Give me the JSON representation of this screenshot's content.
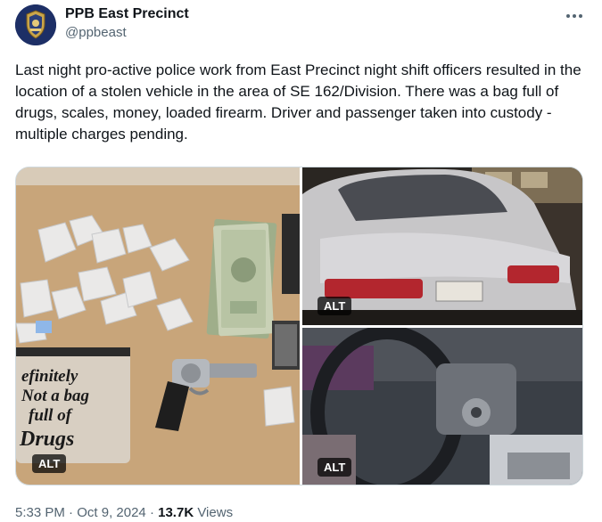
{
  "author": {
    "name": "PPB East Precinct",
    "handle": "@ppbeast"
  },
  "tweet": {
    "text": "Last night pro-active police work from East Precinct night shift officers resulted in the location of a stolen vehicle in the area of SE 162/Division. There was a bag full of drugs, scales, money, loaded firearm. Driver and passenger taken into custody - multiple charges pending."
  },
  "media": {
    "photos": [
      {
        "alt_label": "ALT",
        "bag_text": [
          "efinitely",
          "Not a bag",
          "full of",
          "Drugs"
        ]
      },
      {
        "alt_label": "ALT"
      },
      {
        "alt_label": "ALT"
      }
    ]
  },
  "meta": {
    "time": "5:33 PM",
    "separator": "·",
    "date": "Oct 9, 2024",
    "views_count": "13.7K",
    "views_label": "Views"
  },
  "icons": {
    "more": "more-horizontal-icon",
    "avatar": "police-badge-logo"
  },
  "colors": {
    "text": "#0f1419",
    "secondary": "#536471",
    "border": "#cfd9de",
    "avatar_bg": "#1d2f66"
  }
}
